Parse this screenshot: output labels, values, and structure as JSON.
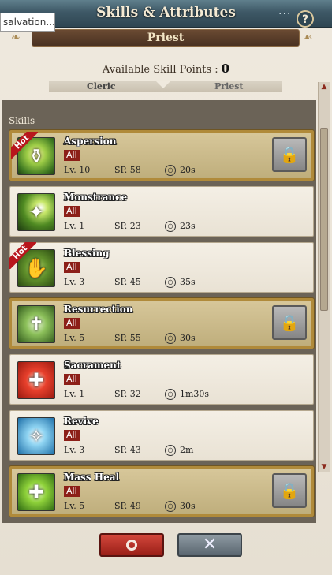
{
  "window": {
    "title": "Skills & Attributes",
    "subtitle": "Priest",
    "tooltip": "salvation...",
    "menu_dots": "···",
    "help_icon": "?",
    "close_icon": "×"
  },
  "skill_points": {
    "label": "Available Skill Points :",
    "value": "0"
  },
  "tabs": [
    {
      "label": "Cleric",
      "active": false
    },
    {
      "label": "Priest",
      "active": true
    }
  ],
  "skills_header": "Skills",
  "skills": [
    {
      "name": "Aspersion",
      "tag": "All",
      "level": "Lv. 10",
      "sp": "SP.  58",
      "cooldown": "20s",
      "locked": true,
      "hot": true,
      "highlight": true,
      "icon": "aspersion-icon"
    },
    {
      "name": "Monstrance",
      "tag": "All",
      "level": "Lv. 1",
      "sp": "SP.  23",
      "cooldown": "23s",
      "locked": false,
      "hot": false,
      "highlight": false,
      "icon": "monstrance-icon"
    },
    {
      "name": "Blessing",
      "tag": "All",
      "level": "Lv. 3",
      "sp": "SP.  45",
      "cooldown": "35s",
      "locked": false,
      "hot": true,
      "highlight": false,
      "icon": "blessing-icon"
    },
    {
      "name": "Resurrection",
      "tag": "All",
      "level": "Lv. 5",
      "sp": "SP.  55",
      "cooldown": "30s",
      "locked": true,
      "hot": false,
      "highlight": true,
      "icon": "resurrection-icon"
    },
    {
      "name": "Sacrament",
      "tag": "All",
      "level": "Lv. 1",
      "sp": "SP.  32",
      "cooldown": "1m30s",
      "locked": false,
      "hot": false,
      "highlight": false,
      "icon": "sacrament-icon"
    },
    {
      "name": "Revive",
      "tag": "All",
      "level": "Lv. 3",
      "sp": "SP.  43",
      "cooldown": "2m",
      "locked": false,
      "hot": false,
      "highlight": false,
      "icon": "revive-icon"
    },
    {
      "name": "Mass Heal",
      "tag": "All",
      "level": "Lv. 5",
      "sp": "SP.  49",
      "cooldown": "30s",
      "locked": true,
      "hot": false,
      "highlight": true,
      "icon": "mass-heal-icon"
    }
  ],
  "hot_label": "Hot",
  "buttons": {
    "confirm": "O",
    "cancel": "✕"
  },
  "colors": {
    "title_bar": "#3e5866",
    "highlight_border": "#b08a3a",
    "confirm": "#b8342a",
    "cancel": "#6f7b84"
  }
}
